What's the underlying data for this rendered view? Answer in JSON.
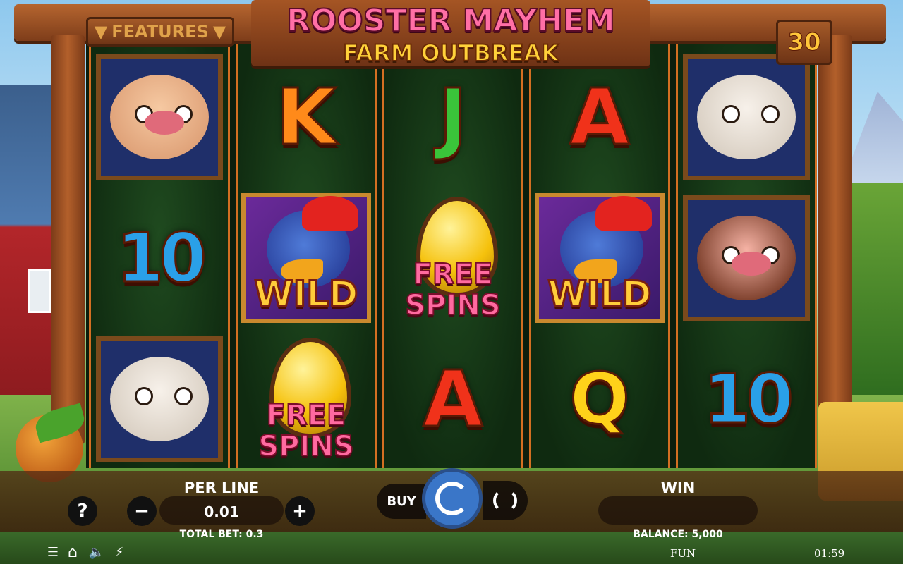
{
  "game": {
    "title_line1": "ROOSTER MAYHEM",
    "title_line2": "FARM OUTBREAK",
    "features_label": "FEATURES",
    "lines_count": "30"
  },
  "reels": [
    [
      {
        "type": "pig"
      },
      {
        "type": "card",
        "text": "10",
        "cls": "ten"
      },
      {
        "type": "goat"
      }
    ],
    [
      {
        "type": "card",
        "text": "K",
        "cls": "k"
      },
      {
        "type": "wild",
        "text": "WILD"
      },
      {
        "type": "freespins",
        "text1": "FREE",
        "text2": "SPINS"
      }
    ],
    [
      {
        "type": "card",
        "text": "J",
        "cls": "j"
      },
      {
        "type": "freespins",
        "text1": "FREE",
        "text2": "SPINS"
      },
      {
        "type": "card",
        "text": "A",
        "cls": "a"
      }
    ],
    [
      {
        "type": "card",
        "text": "A",
        "cls": "a"
      },
      {
        "type": "wild",
        "text": "WILD"
      },
      {
        "type": "card",
        "text": "Q",
        "cls": "q"
      }
    ],
    [
      {
        "type": "goat"
      },
      {
        "type": "cow"
      },
      {
        "type": "card",
        "text": "10",
        "cls": "ten"
      }
    ]
  ],
  "controls": {
    "help_label": "?",
    "minus_label": "−",
    "plus_label": "+",
    "per_line_label": "PER LINE",
    "per_line_value": "0.01",
    "total_bet": "TOTAL BET: 0.3",
    "buy_label": "BUY",
    "win_label": "WIN",
    "win_value": "",
    "balance": "BALANCE: 5,000"
  },
  "status": {
    "mode": "FUN",
    "clock": "01:59"
  },
  "icons": {
    "menu": "☰",
    "home": "⌂",
    "sound": "🔈",
    "turbo": "⚡"
  },
  "colors": {
    "frame": "#d36f22",
    "spin": "#3a76c8",
    "title_pink": "#ff6fa6",
    "title_gold": "#ffd23a"
  }
}
